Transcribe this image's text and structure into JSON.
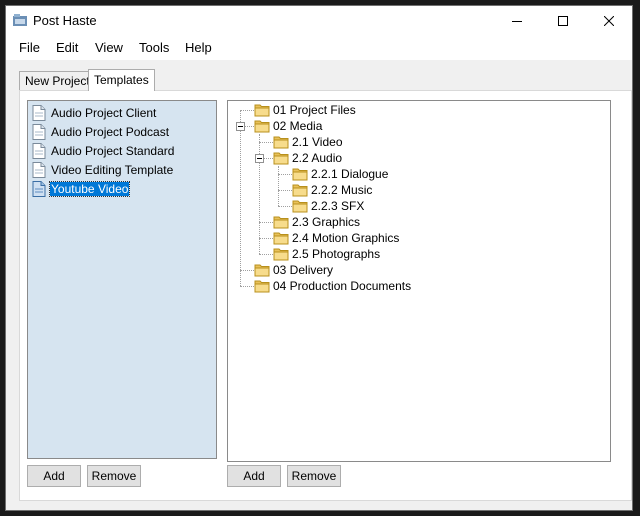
{
  "window": {
    "title": "Post Haste"
  },
  "menu": [
    "File",
    "Edit",
    "View",
    "Tools",
    "Help"
  ],
  "tabs": [
    {
      "label": "New Project",
      "active": false
    },
    {
      "label": "Templates",
      "active": true
    }
  ],
  "templates": {
    "items": [
      {
        "label": "Audio Project Client",
        "selected": false
      },
      {
        "label": "Audio Project Podcast",
        "selected": false
      },
      {
        "label": "Audio Project Standard",
        "selected": false
      },
      {
        "label": "Video Editing Template",
        "selected": false
      },
      {
        "label": "Youtube Video",
        "selected": true
      }
    ],
    "add_label": "Add",
    "remove_label": "Remove"
  },
  "folder_tree": {
    "nodes": [
      {
        "label": "01 Project Files",
        "level": 0
      },
      {
        "label": "02 Media",
        "level": 0,
        "expanded": true
      },
      {
        "label": "2.1 Video",
        "level": 1
      },
      {
        "label": "2.2 Audio",
        "level": 1,
        "expanded": true
      },
      {
        "label": "2.2.1 Dialogue",
        "level": 2
      },
      {
        "label": "2.2.2 Music",
        "level": 2
      },
      {
        "label": "2.2.3 SFX",
        "level": 2
      },
      {
        "label": "2.3 Graphics",
        "level": 1
      },
      {
        "label": "2.4 Motion Graphics",
        "level": 1
      },
      {
        "label": "2.5 Photographs",
        "level": 1
      },
      {
        "label": "03 Delivery",
        "level": 0
      },
      {
        "label": "04 Production Documents",
        "level": 0
      }
    ],
    "add_label": "Add",
    "remove_label": "Remove"
  }
}
